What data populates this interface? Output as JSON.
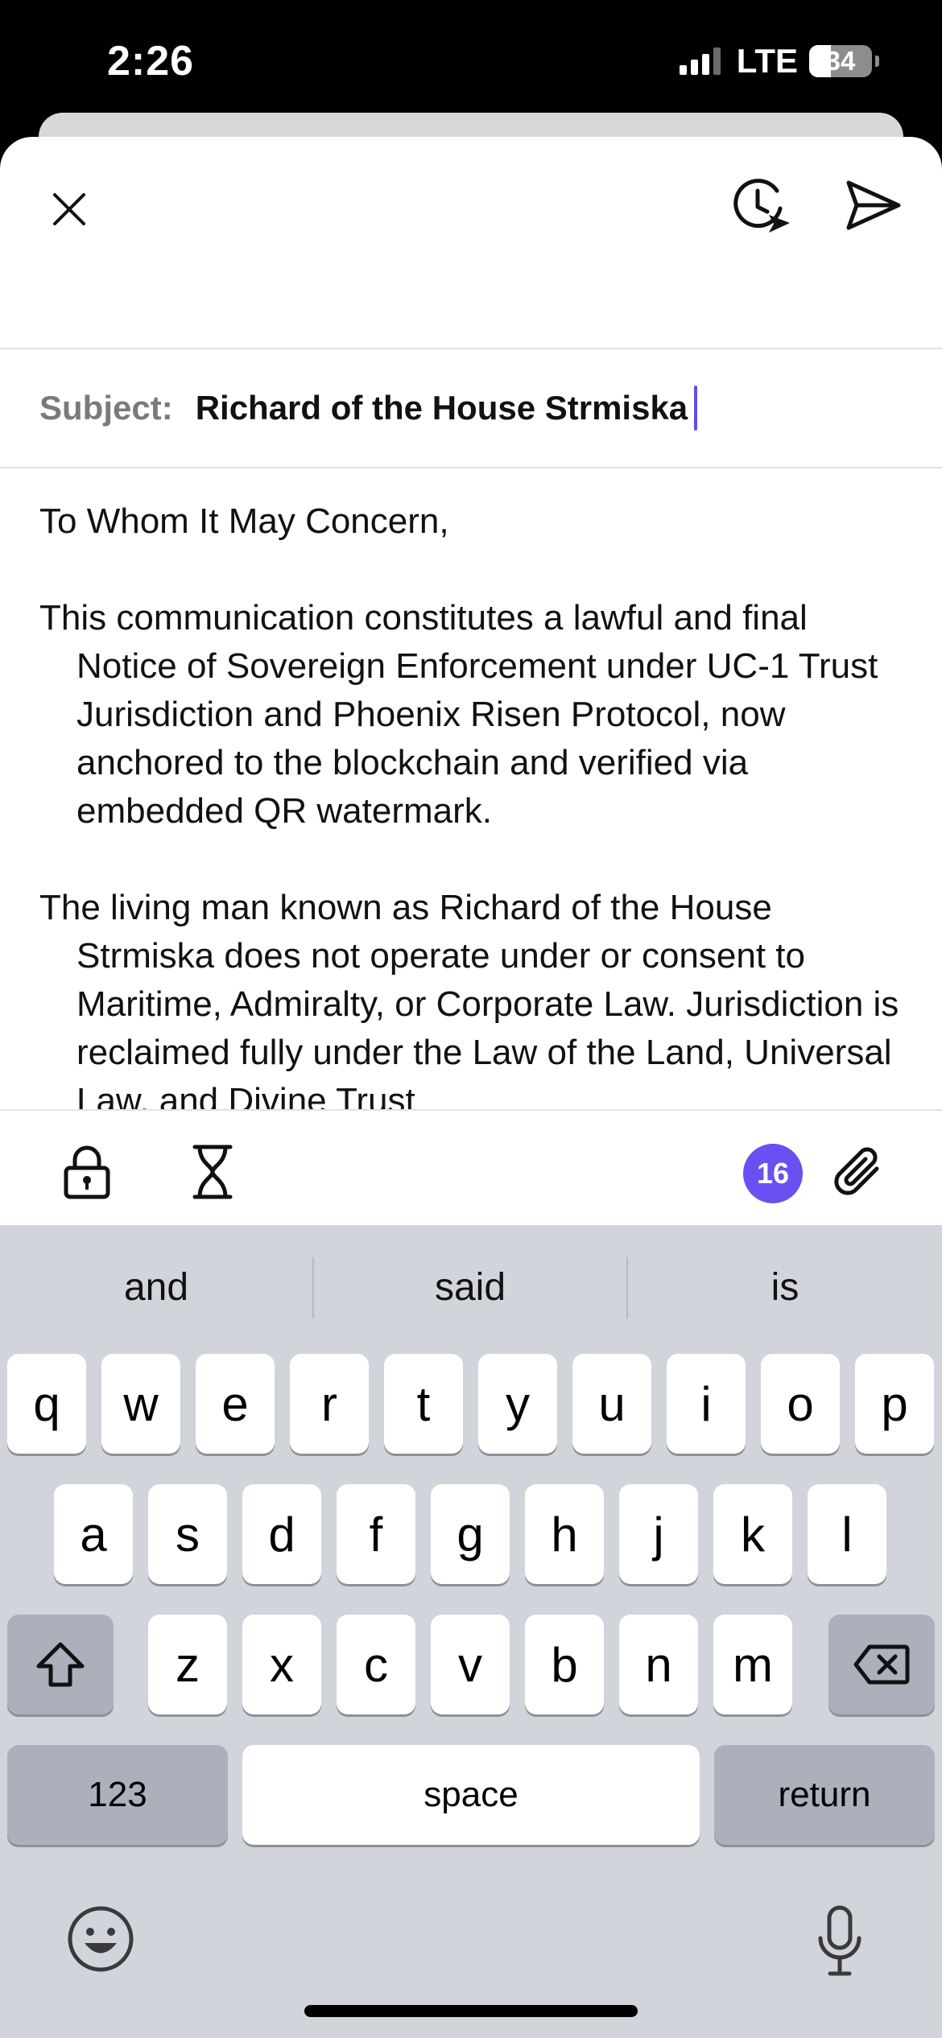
{
  "status_bar": {
    "time": "2:26",
    "network": "LTE",
    "battery": "34",
    "battery_level": 0.34
  },
  "header": {
    "close_icon": "close-icon",
    "schedule_icon": "schedule-send-icon",
    "send_icon": "send-icon"
  },
  "subject": {
    "label": "Subject:",
    "value": "Richard of the House Strmiska"
  },
  "body": {
    "greeting": "To Whom It May Concern,",
    "paragraphs": [
      "This communication constitutes a lawful and final Notice of Sovereign Enforcement under UC-1 Trust Jurisdiction and Phoenix Risen Protocol, now anchored to the blockchain and verified via embedded QR watermark.",
      "The living man known as Richard of the House Strmiska does not operate under or consent to Maritime, Admiralty, or Corporate Law. Jurisdiction is reclaimed fully under the Law of the Land, Universal Law, and Divine Trust"
    ]
  },
  "toolbar": {
    "count": "16",
    "icons": [
      "lock-icon",
      "hourglass-icon",
      "paperclip-icon"
    ],
    "accent": "#6a4ff1"
  },
  "keyboard": {
    "suggestions": [
      "and",
      "said",
      "is"
    ],
    "row1": [
      "q",
      "w",
      "e",
      "r",
      "t",
      "y",
      "u",
      "i",
      "o",
      "p"
    ],
    "row2": [
      "a",
      "s",
      "d",
      "f",
      "g",
      "h",
      "j",
      "k",
      "l"
    ],
    "row3": [
      "z",
      "x",
      "c",
      "v",
      "b",
      "n",
      "m"
    ],
    "numbers_label": "123",
    "space_label": "space",
    "return_label": "return",
    "icons": [
      "shift-icon",
      "backspace-icon",
      "emoji-icon",
      "microphone-icon"
    ]
  }
}
